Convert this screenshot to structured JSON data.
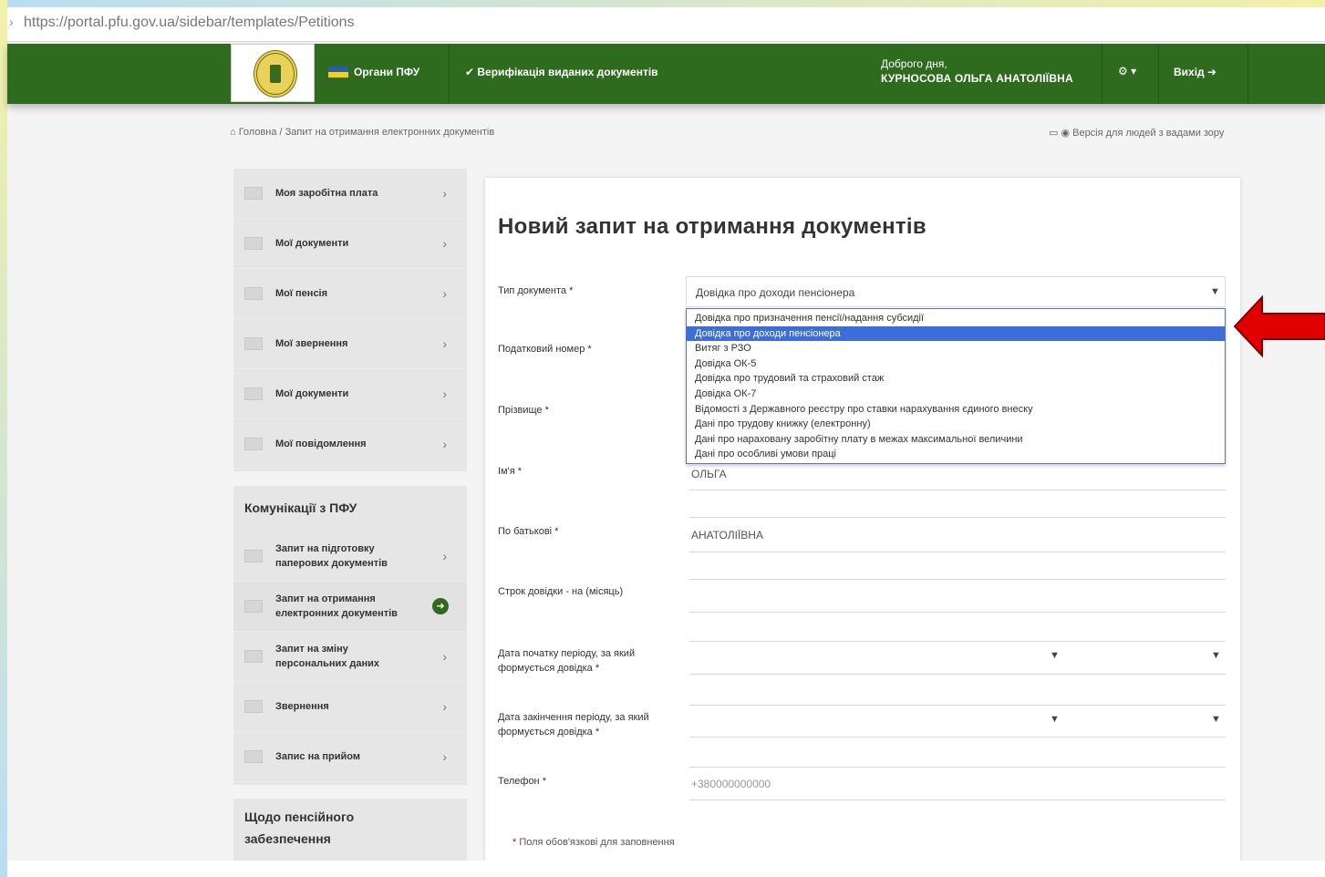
{
  "browser": {
    "url": "https://portal.pfu.gov.ua/sidebar/templates/Petitions"
  },
  "header": {
    "organs_label": "Органи ПФУ",
    "verification_label": "Верифікація виданих документів",
    "welcome_prefix": "Доброго дня,",
    "user_name": "КУРНОСОВА ОЛЬГА АНАТОЛІЇВНА",
    "settings_label": "▾",
    "logout_label": "Вихід"
  },
  "breadcrumb": "Головна / Запит на отримання електронних документів",
  "accessibility_tools": "Версія для людей з вадами зору",
  "sidebar": {
    "items": [
      {
        "label": "Моя заробітна плата"
      },
      {
        "label": "Мої документи"
      },
      {
        "label": "Мої пенсія"
      },
      {
        "label": "Мої звернення"
      },
      {
        "label": "Мої документи"
      },
      {
        "label": "Мої повідомлення"
      }
    ],
    "comm_heading": "Комунікації з ПФУ",
    "comm_items": [
      {
        "label": "Запит на підготовку",
        "sub": "паперових документів"
      },
      {
        "label": "Запит на отримання",
        "sub": "електронних документів"
      },
      {
        "label": "Запит на зміну",
        "sub": "персональних даних"
      },
      {
        "label": "Звернення",
        "sub": ""
      },
      {
        "label": "Запис на прийом",
        "sub": ""
      }
    ],
    "pension_heading_line1": "Щодо пенсійного",
    "pension_heading_line2": "забезпечення"
  },
  "form": {
    "title": "Новий запит на отримання документів",
    "doc_type_label": "Тип документа *",
    "doc_type_value": "Довідка про доходи пенсіонера",
    "options": [
      "Довідка про призначення пенсії/надання субсидії",
      "Довідка про доходи пенсіонера",
      "Витяг з РЗО",
      "Довідка ОК-5",
      "Довідка про трудовий та страховий стаж",
      "Довідка ОК-7",
      "Відомості з Державного реєстру про ставки нарахування єдиного внеску",
      "Дані про трудову книжку (електронну)",
      "Дані про нараховану заробітну плату в межах максимальної величини",
      "Дані про особливі умови праці"
    ],
    "selected_option_index": 1,
    "tax_id_label": "Податковий номер *",
    "surname_label": "Прізвище *",
    "name_label": "Ім'я *",
    "name_value": "ОЛЬГА",
    "patronymic_label": "По батькові *",
    "patronymic_value": "АНАТОЛІЇВНА",
    "validity_label": "Строк довідки - на (місяць)",
    "period_start_label": "Дата початку періоду, за який формується довідка *",
    "period_end_label": "Дата закінчення періоду, за який формується довідка *",
    "phone_label": "Телефон *",
    "phone_placeholder": "+380000000000",
    "footnote": "Поля обов'язкові для заповнення"
  },
  "colors": {
    "header_green": "#2f6b1e",
    "selected_option": "#3d6dd8",
    "arrow_red": "#e00000"
  }
}
